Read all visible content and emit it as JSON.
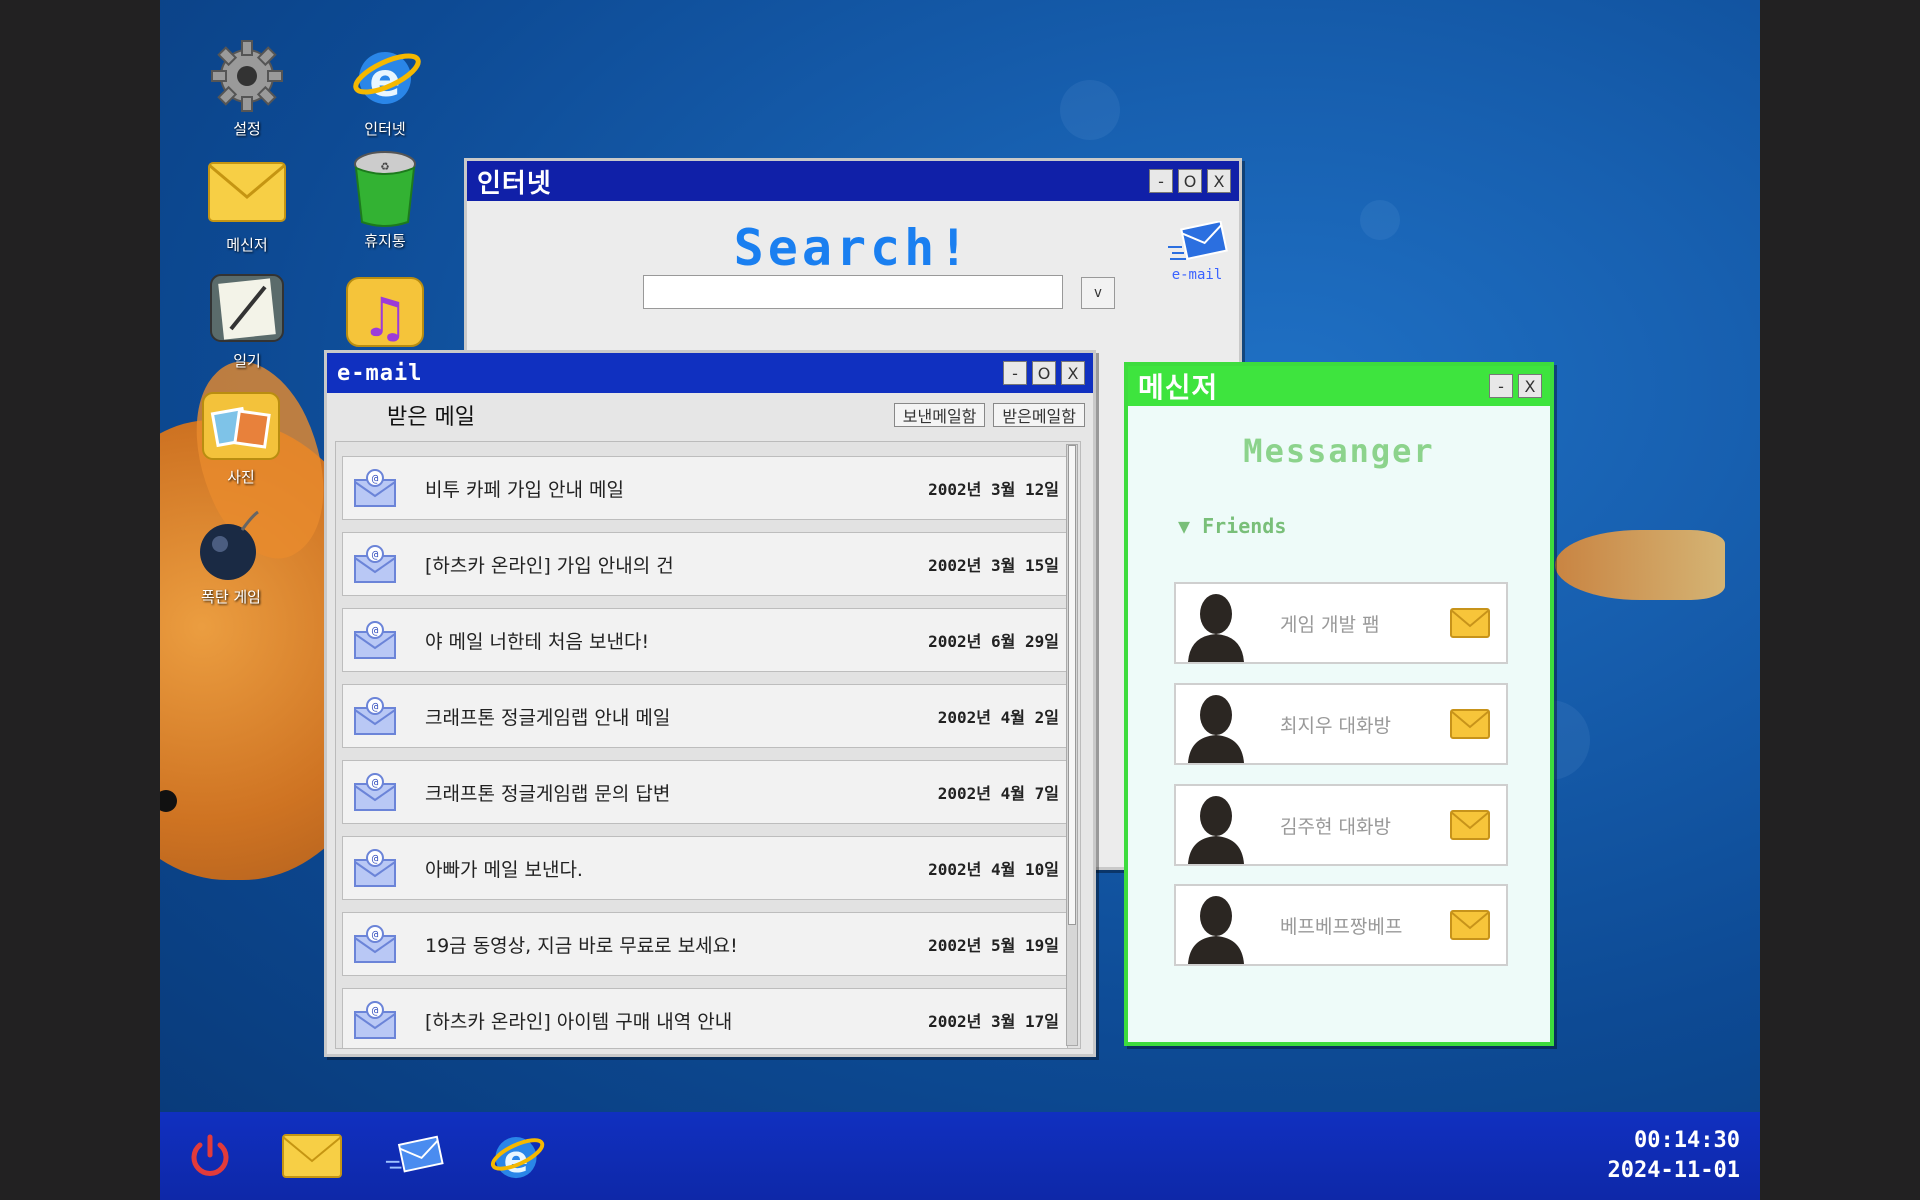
{
  "desktop": {
    "icons": [
      {
        "label": "설정",
        "icon": "gear-icon"
      },
      {
        "label": "인터넷",
        "icon": "browser-icon"
      },
      {
        "label": "메신저",
        "icon": "envelope-icon"
      },
      {
        "label": "휴지통",
        "icon": "trash-icon"
      },
      {
        "label": "일기",
        "icon": "diary-icon"
      },
      {
        "label": "",
        "icon": "music-icon"
      },
      {
        "label": "사진",
        "icon": "photo-folder-icon"
      },
      {
        "label": "폭탄 게임",
        "icon": "bomb-icon"
      }
    ]
  },
  "internet": {
    "title": "인터넷",
    "search_title": "Search!",
    "search_value": "",
    "go_label": "v",
    "email_link": "e-mail",
    "buttons": {
      "minimize": "-",
      "maximize": "O",
      "close": "X"
    }
  },
  "email": {
    "title": "e-mail",
    "inbox_title": "받은 메일",
    "sent_box": "보낸메일함",
    "inbox_box": "받은메일함",
    "buttons": {
      "minimize": "-",
      "maximize": "O",
      "close": "X"
    },
    "mails": [
      {
        "subject": "비투 카페 가입 안내 메일",
        "date": "2002년 3월 12일"
      },
      {
        "subject": "[하츠카 온라인] 가입 안내의 건",
        "date": "2002년 3월 15일"
      },
      {
        "subject": "야 메일 너한테 처음 보낸다!",
        "date": "2002년 6월 29일"
      },
      {
        "subject": "크래프톤 정글게임랩 안내 메일",
        "date": "2002년 4월 2일"
      },
      {
        "subject": "크래프톤 정글게임랩 문의 답변",
        "date": "2002년 4월 7일"
      },
      {
        "subject": "아빠가 메일 보낸다.",
        "date": "2002년 4월 10일"
      },
      {
        "subject": "19금 동영상, 지금 바로 무료로 보세요!",
        "date": "2002년 5월 19일"
      },
      {
        "subject": "[하츠카 온라인] 아이템 구매 내역 안내",
        "date": "2002년 3월 17일"
      }
    ]
  },
  "messenger": {
    "title": "메신저",
    "heading": "Messanger",
    "friends_label": "▼ Friends",
    "buttons": {
      "minimize": "-",
      "close": "X"
    },
    "friends": [
      {
        "name": "게임 개발 팸"
      },
      {
        "name": "최지우 대화방"
      },
      {
        "name": "김주현 대화방"
      },
      {
        "name": "베프베프짱베프"
      }
    ]
  },
  "taskbar": {
    "items": [
      "power-icon",
      "envelope-icon",
      "email-send-icon",
      "browser-icon"
    ],
    "time": "00:14:30",
    "date": "2024-11-01"
  },
  "colors": {
    "taskbar": "#1030c0",
    "internet_titlebar": "#1020a8",
    "messenger_titlebar": "#3ee43e",
    "search_accent": "#1a7ff0"
  }
}
